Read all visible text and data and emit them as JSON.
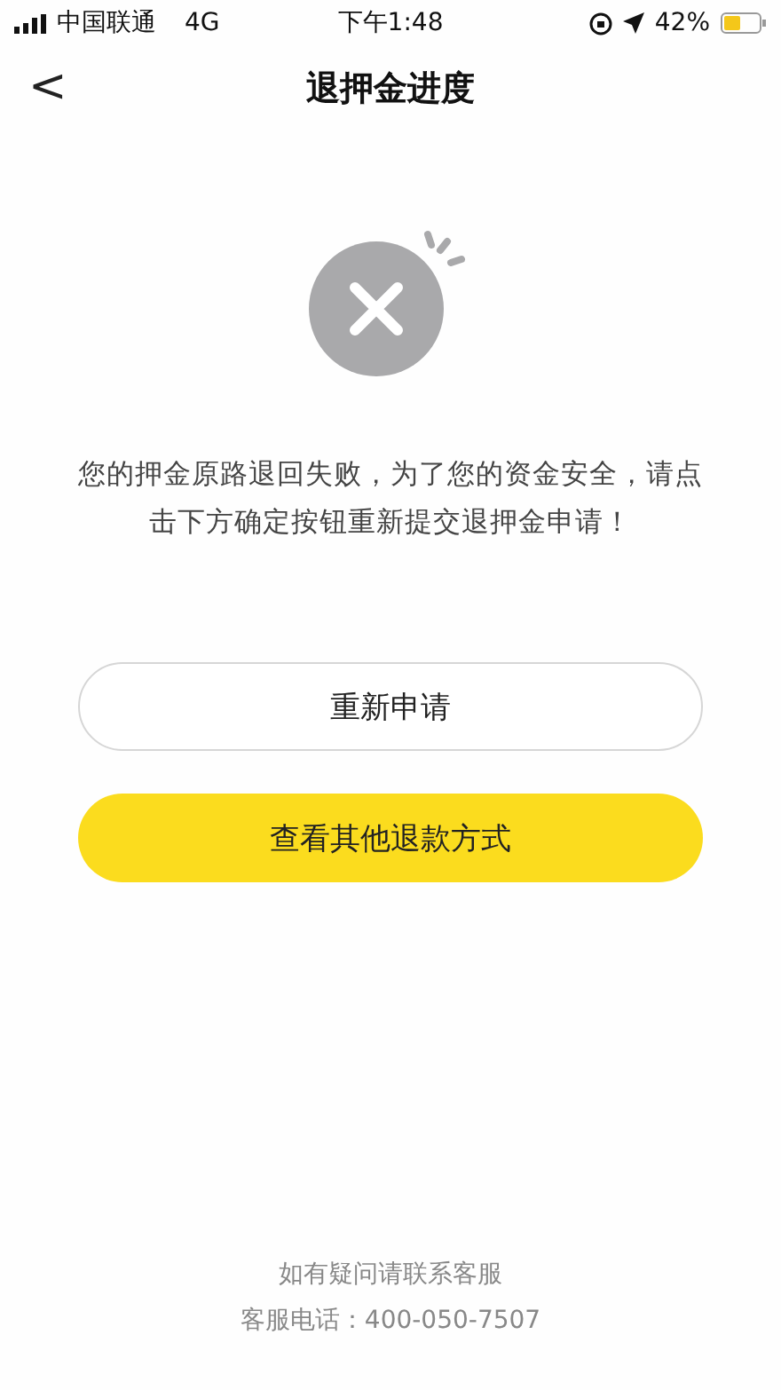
{
  "status_bar": {
    "carrier": "中国联通",
    "network": "4G",
    "time": "下午1:48",
    "battery": "42%"
  },
  "nav": {
    "back": "<",
    "title": "退押金进度"
  },
  "message": "您的押金原路退回失败，为了您的资金安全，请点击下方确定按钮重新提交退押金申请！",
  "buttons": [
    {
      "label": "重新申请",
      "kind": "outline"
    },
    {
      "label": "查看其他退款方式",
      "kind": "primary"
    }
  ],
  "footer": {
    "note": "如有疑问请联系客服",
    "phone": "客服电话：400-050-7507"
  }
}
